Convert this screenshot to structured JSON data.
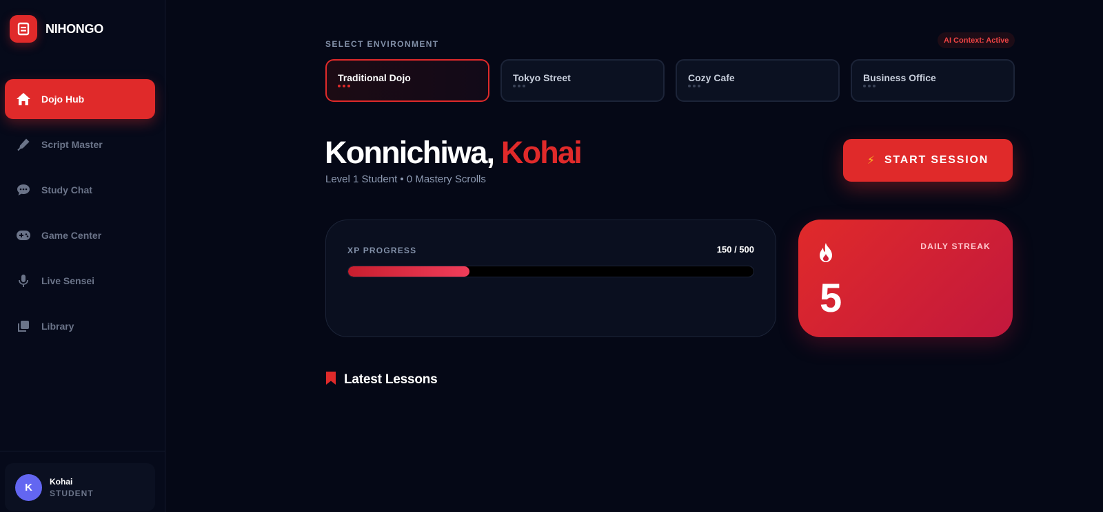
{
  "brand": {
    "name": "NIHONGO",
    "logo_icon": "book-icon"
  },
  "sidebar": {
    "items": [
      {
        "label": "Dojo Hub",
        "icon": "home-icon",
        "active": true
      },
      {
        "label": "Script Master",
        "icon": "pen-icon",
        "active": false
      },
      {
        "label": "Study Chat",
        "icon": "chat-icon",
        "active": false
      },
      {
        "label": "Game Center",
        "icon": "gamepad-icon",
        "active": false
      },
      {
        "label": "Live Sensei",
        "icon": "microphone-icon",
        "active": false
      },
      {
        "label": "Library",
        "icon": "library-icon",
        "active": false
      }
    ]
  },
  "user": {
    "initial": "K",
    "name": "Kohai",
    "role": "STUDENT"
  },
  "environment": {
    "label": "SELECT ENVIRONMENT",
    "ai_badge": "AI Context: Active",
    "options": [
      {
        "name": "Traditional Dojo",
        "selected": true
      },
      {
        "name": "Tokyo Street",
        "selected": false
      },
      {
        "name": "Cozy Cafe",
        "selected": false
      },
      {
        "name": "Business Office",
        "selected": false
      }
    ]
  },
  "greeting": {
    "prefix": "Konnichiwa, ",
    "name": "Kohai",
    "subtitle": "Level 1 Student • 0 Mastery Scrolls"
  },
  "start_button": {
    "label": "START SESSION",
    "icon": "lightning-icon"
  },
  "xp": {
    "label": "XP PROGRESS",
    "value_text": "150 / 500",
    "current": 150,
    "max": 500
  },
  "streak": {
    "label": "DAILY STREAK",
    "value": "5",
    "icon": "fire-icon"
  },
  "lessons": {
    "title": "Latest Lessons",
    "icon": "bookmark-icon"
  },
  "colors": {
    "accent": "#e02a2a",
    "background": "#050816",
    "sidebar": "#060a1a",
    "avatar": "#6366f1",
    "streak_gradient_end": "#c2183d"
  }
}
